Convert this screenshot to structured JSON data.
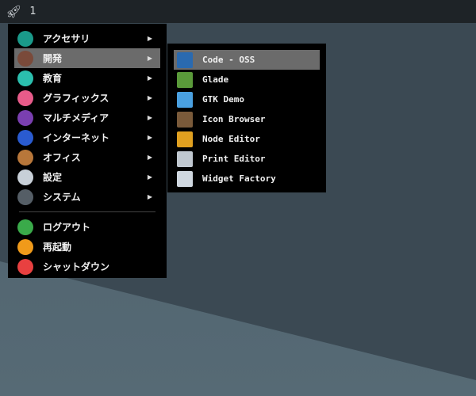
{
  "topbar": {
    "workspace": "1"
  },
  "main_menu": {
    "items": [
      {
        "label": "アクセサリ",
        "icon": "accessories-icon",
        "color": "#1a9a8a"
      },
      {
        "label": "開発",
        "icon": "development-hammer-icon",
        "color": "#7a4a3a"
      },
      {
        "label": "教育",
        "icon": "education-icon",
        "color": "#2bbfae"
      },
      {
        "label": "グラフィックス",
        "icon": "graphics-icon",
        "color": "#e85b8a"
      },
      {
        "label": "マルチメディア",
        "icon": "multimedia-icon",
        "color": "#7a3fb0"
      },
      {
        "label": "インターネット",
        "icon": "internet-icon",
        "color": "#2a5bd0"
      },
      {
        "label": "オフィス",
        "icon": "office-briefcase-icon",
        "color": "#b8773a"
      },
      {
        "label": "設定",
        "icon": "settings-icon",
        "color": "#c8d0d8"
      },
      {
        "label": "システム",
        "icon": "system-gear-icon",
        "color": "#555e66"
      }
    ],
    "actions": [
      {
        "label": "ログアウト",
        "icon": "logout-icon",
        "color": "#3aaa4a"
      },
      {
        "label": "再起動",
        "icon": "restart-icon",
        "color": "#f09a1a"
      },
      {
        "label": "シャットダウン",
        "icon": "shutdown-icon",
        "color": "#e84040"
      }
    ]
  },
  "submenu": {
    "items": [
      {
        "label": "Code - OSS",
        "icon": "code-oss-icon",
        "color": "#2a6ab0"
      },
      {
        "label": "Glade",
        "icon": "glade-icon",
        "color": "#5a9a3a"
      },
      {
        "label": "GTK Demo",
        "icon": "gtk-demo-icon",
        "color": "#4aa0e0"
      },
      {
        "label": "Icon Browser",
        "icon": "icon-browser-icon",
        "color": "#7a5a3a"
      },
      {
        "label": "Node Editor",
        "icon": "node-editor-icon",
        "color": "#e0a020"
      },
      {
        "label": "Print Editor",
        "icon": "print-editor-icon",
        "color": "#c0c8d0"
      },
      {
        "label": "Widget Factory",
        "icon": "widget-factory-icon",
        "color": "#d0d8e0"
      }
    ]
  }
}
